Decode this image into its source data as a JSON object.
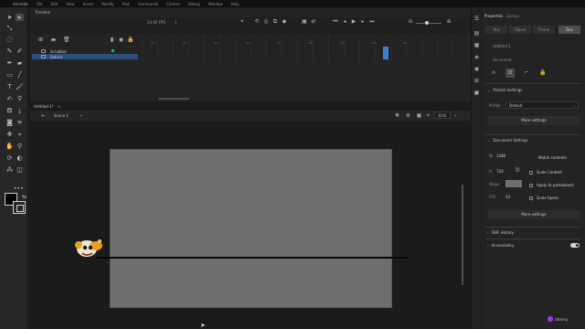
{
  "menubar": {
    "app_name": "Animate",
    "items": [
      "File",
      "Edit",
      "View",
      "Insert",
      "Modify",
      "Text",
      "Commands",
      "Control",
      "Debug",
      "Window",
      "Help"
    ]
  },
  "timeline": {
    "panel_title": "Timeline",
    "fps": "24.00 FPS",
    "frame": "1",
    "frame_numbers": [
      "10",
      "20",
      "30",
      "40",
      "50",
      "60",
      "70",
      "80",
      "90"
    ],
    "layers": [
      {
        "name": "Scrubber",
        "selected": false,
        "keyframe_color": "#00c46f"
      },
      {
        "name": "Saturn",
        "selected": true,
        "keyframe_color": "#3d7fd3"
      }
    ]
  },
  "document": {
    "tab_title": "Untitled-1*",
    "scene_label": "Scene 1",
    "zoom": "81%",
    "stage_color": "#6e6e6e"
  },
  "properties": {
    "tabs": [
      "Properties",
      "Library"
    ],
    "segments": [
      "Tool",
      "Object",
      "Frame",
      "Doc"
    ],
    "active_segment": "Doc",
    "doc_name": "Untitled-1",
    "doc_type": "Document",
    "publish": {
      "header": "Publish Settings",
      "profile_label": "Profile",
      "profile_value": "Default",
      "more_button": "More settings"
    },
    "doc_settings": {
      "header": "Document Settings",
      "width_label": "W",
      "width": "1280",
      "height_label": "H",
      "height": "720",
      "match_contents": "Match contents",
      "scale_content": "Scale Content",
      "apply_pasteboard": "Apply to pasteboard",
      "scale_spans": "Scale Spans",
      "stage_label": "Stage",
      "fps_label": "FPS",
      "fps": "24",
      "more_button": "More settings"
    },
    "swf_history": "SWF History",
    "accessibility": "Accessibility"
  },
  "watermark": "Udemy"
}
